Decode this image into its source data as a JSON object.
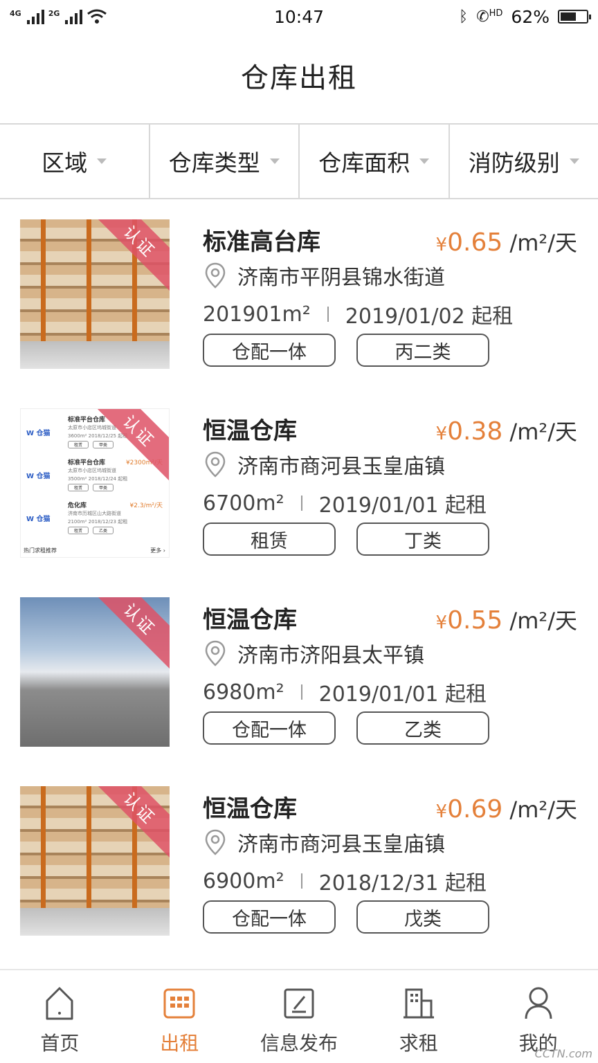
{
  "status_bar": {
    "network_left": "4G",
    "network_right": "2G",
    "time": "10:47",
    "hd_label": "HD",
    "battery_level": 62,
    "battery": "62%"
  },
  "header": {
    "title": "仓库出租"
  },
  "filters": [
    {
      "label": "区域"
    },
    {
      "label": "仓库类型"
    },
    {
      "label": "仓库面积"
    },
    {
      "label": "消防级别"
    }
  ],
  "listings": [
    {
      "title": "标准高台库",
      "currency": "¥",
      "price": "0.65",
      "unit": "/m²/天",
      "address": "济南市平阴县锦水街道",
      "area": "201901m²",
      "start": "2019/01/02 起租",
      "tags": [
        "仓配一体",
        "丙二类"
      ],
      "badge": "认证",
      "thumb": "warehouse-shelves"
    },
    {
      "title": "恒温仓库",
      "currency": "¥",
      "price": "0.38",
      "unit": "/m²/天",
      "address": "济南市商河县玉皇庙镇",
      "area": "6700m²",
      "start": "2019/01/01 起租",
      "tags": [
        "租赁",
        "丁类"
      ],
      "badge": "认证",
      "thumb": "app-screenshot",
      "thumb_content": {
        "rows": [
          {
            "title": "标准平台仓库",
            "price": "",
            "line1": "太原市小店区坞城街道",
            "line2": "3600m²  2018/12/25 起租",
            "tags": [
              "租赁",
              "甲类"
            ]
          },
          {
            "title": "标准平台仓库",
            "price": "¥2300m²/天",
            "line1": "太原市小店区坞城街道",
            "line2": "3500m²  2018/12/24 起租",
            "tags": [
              "租赁",
              "甲类"
            ]
          },
          {
            "title": "危化库",
            "price": "¥2.3/m²/天",
            "line1": "济南市历城区山大路街道",
            "line2": "2100m²  2018/12/23 起租",
            "tags": [
              "租赁",
              "乙类"
            ]
          }
        ],
        "footer_left": "热门求租推荐",
        "footer_right": "更多 ›",
        "logo": "W 仓猫"
      }
    },
    {
      "title": "恒温仓库",
      "currency": "¥",
      "price": "0.55",
      "unit": "/m²/天",
      "address": "济南市济阳县太平镇",
      "area": "6980m²",
      "start": "2019/01/01 起租",
      "tags": [
        "仓配一体",
        "乙类"
      ],
      "badge": "认证",
      "thumb": "outdoor-yard"
    },
    {
      "title": "恒温仓库",
      "currency": "¥",
      "price": "0.69",
      "unit": "/m²/天",
      "address": "济南市商河县玉皇庙镇",
      "area": "6900m²",
      "start": "2018/12/31 起租",
      "tags": [
        "仓配一体",
        "戊类"
      ],
      "badge": "认证",
      "thumb": "warehouse-shelves"
    }
  ],
  "tabs": [
    {
      "label": "首页",
      "icon": "home-icon",
      "active": false
    },
    {
      "label": "出租",
      "icon": "warehouse-icon",
      "active": true
    },
    {
      "label": "信息发布",
      "icon": "edit-icon",
      "active": false
    },
    {
      "label": "求租",
      "icon": "building-icon",
      "active": false
    },
    {
      "label": "我的",
      "icon": "user-icon",
      "active": false
    }
  ],
  "colors": {
    "accent": "#e4803a",
    "badge": "#de5266",
    "text": "#333333"
  },
  "watermark": "CCTN.com"
}
